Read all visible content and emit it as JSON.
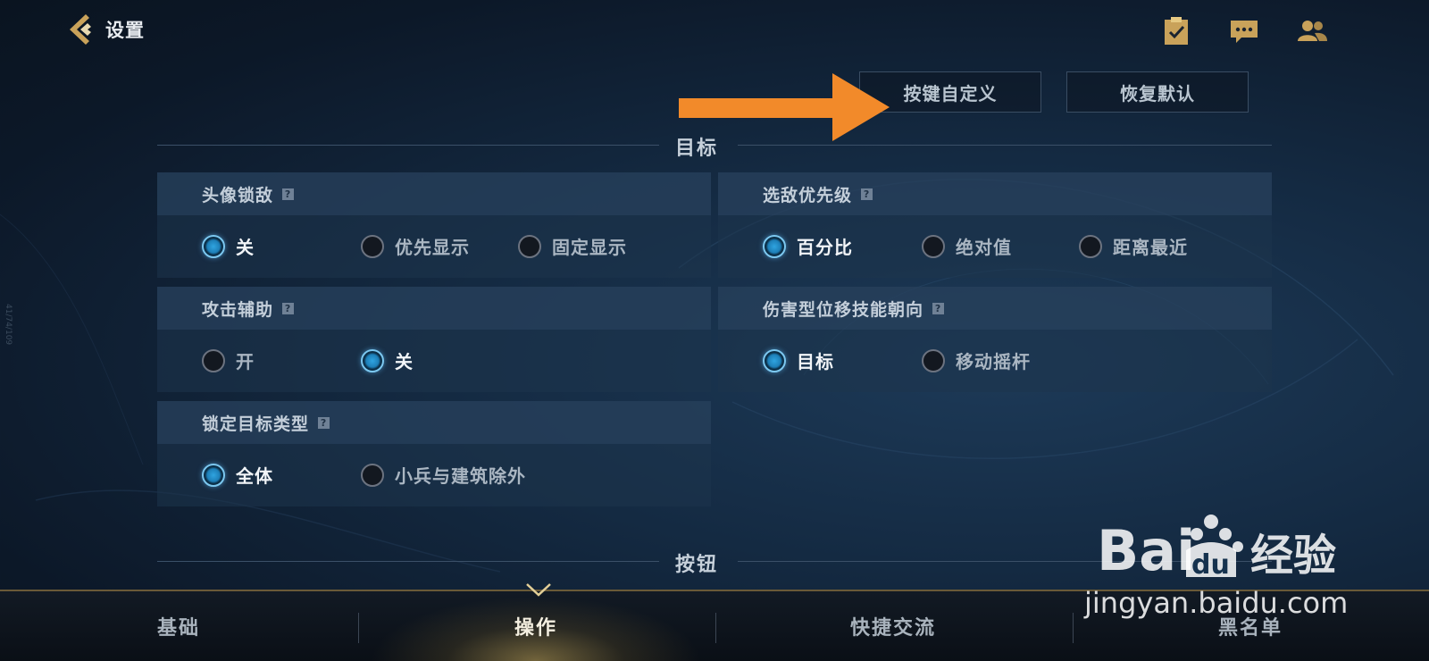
{
  "header": {
    "back_title": "设置",
    "icons": [
      "task-icon",
      "chat-icon",
      "friends-icon"
    ]
  },
  "toolbar": {
    "custom_keys": "按键自定义",
    "restore_default": "恢复默认"
  },
  "sections": {
    "target": "目标",
    "buttons": "按钮"
  },
  "panels": [
    {
      "title": "头像锁敌",
      "options": [
        "关",
        "优先显示",
        "固定显示"
      ],
      "selected": 0
    },
    {
      "title": "选敌优先级",
      "options": [
        "百分比",
        "绝对值",
        "距离最近"
      ],
      "selected": 0
    },
    {
      "title": "攻击辅助",
      "options": [
        "开",
        "关"
      ],
      "selected": 1
    },
    {
      "title": "伤害型位移技能朝向",
      "options": [
        "目标",
        "移动摇杆"
      ],
      "selected": 0
    },
    {
      "title": "锁定目标类型",
      "options": [
        "全体",
        "小兵与建筑除外"
      ],
      "selected": 0
    }
  ],
  "help_glyph": "?",
  "tabs": [
    "基础",
    "操作",
    "快捷交流",
    "黑名单"
  ],
  "active_tab": 1,
  "watermark": {
    "brand": "Bai du 经验",
    "url": "jingyan.baidu.com"
  },
  "side_code": "41/74/109",
  "colors": {
    "accent_gold": "#c9a25a",
    "arrow": "#f28a2a",
    "radio_on": "#2fa4e0"
  }
}
